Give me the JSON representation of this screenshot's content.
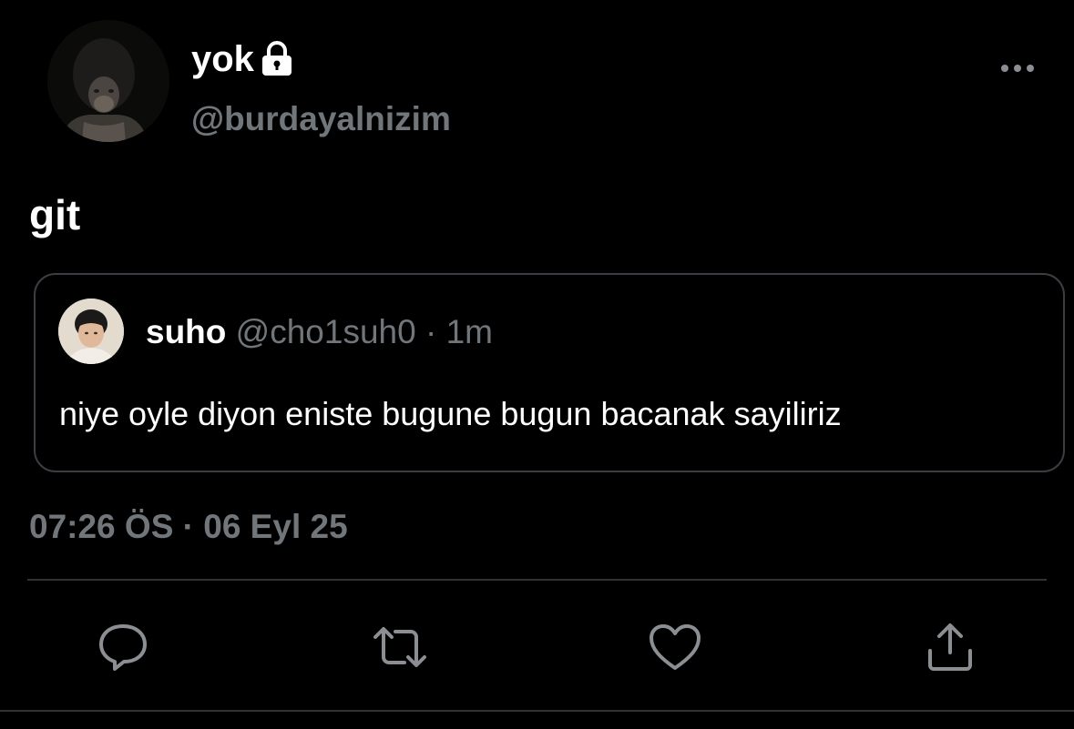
{
  "author": {
    "display_name": "yok",
    "handle": "@burdayalnizim",
    "protected_icon": "lock-icon"
  },
  "tweet": {
    "text": "git",
    "timestamp": "07:26 ÖS · 06 Eyl 25"
  },
  "quoted_tweet": {
    "display_name": "suho",
    "meta": "@cho1suh0 · 1m",
    "text": "niye oyle diyon eniste bugune bugun bacanak sayiliriz"
  },
  "actions": [
    {
      "name": "reply",
      "icon": "speech-bubble-icon"
    },
    {
      "name": "retweet",
      "icon": "retweet-icon"
    },
    {
      "name": "like",
      "icon": "heart-icon"
    },
    {
      "name": "share",
      "icon": "share-upload-icon"
    }
  ],
  "colors": {
    "background": "#000000",
    "primary_text": "#ffffff",
    "secondary_text": "#71767b",
    "border": "#2f3336"
  }
}
